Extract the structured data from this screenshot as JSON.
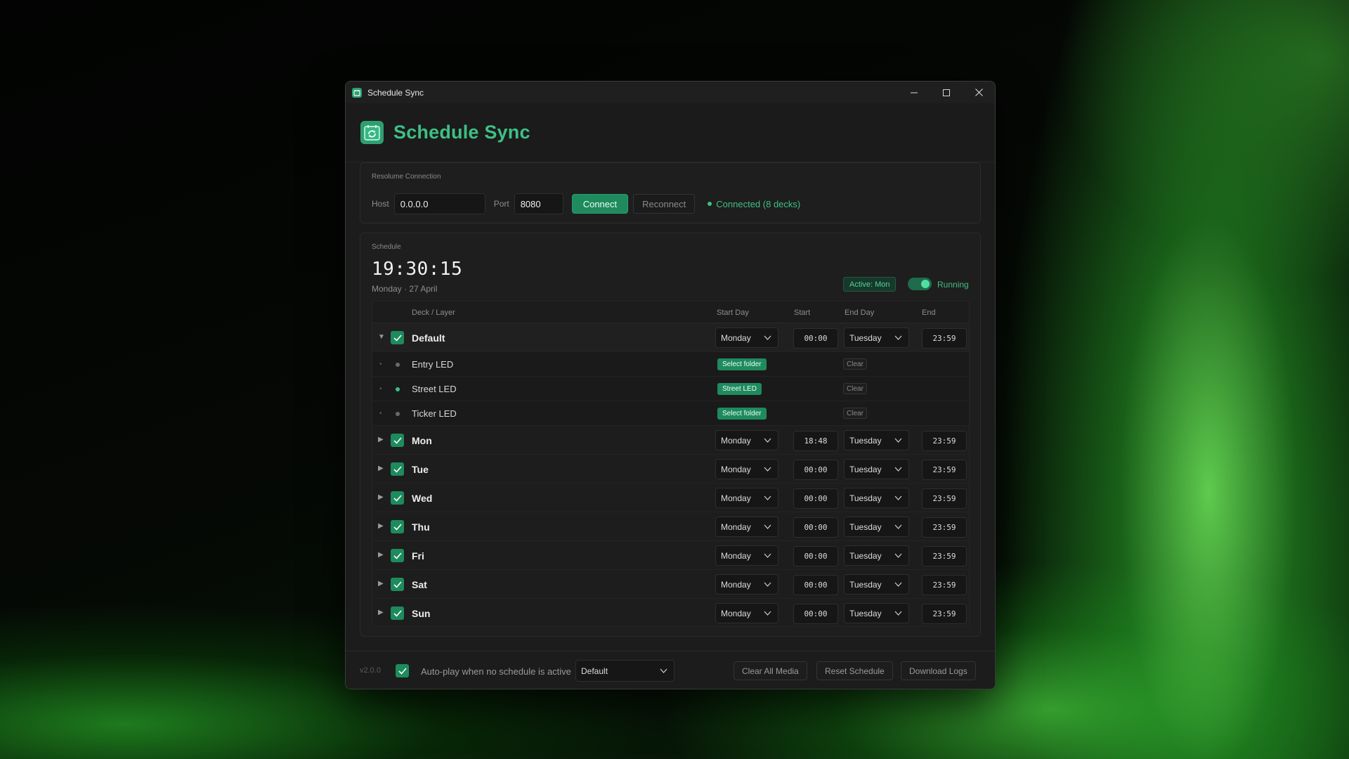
{
  "window": {
    "title": "Schedule Sync",
    "minimize_icon": "minimize-icon",
    "maximize_icon": "maximize-icon",
    "close_icon": "close-icon"
  },
  "app": {
    "title": "Schedule Sync",
    "logo_icon": "calendar-sync-icon",
    "accent": "#3fbf85"
  },
  "connection": {
    "section_label": "Resolume Connection",
    "host_label": "Host",
    "host_value": "0.0.0.0",
    "port_label": "Port",
    "port_value": "8080",
    "connect_label": "Connect",
    "reconnect_label": "Reconnect",
    "status_text": "Connected (8 decks)"
  },
  "schedule": {
    "section_label": "Schedule",
    "clock": "19:30:15",
    "date": "Monday · 27 April",
    "active_badge": "Active: Mon",
    "running_label": "Running",
    "running_on": true,
    "columns": {
      "deck": "Deck / Layer",
      "start_day": "Start Day",
      "start": "Start",
      "end_day": "End Day",
      "end": "End"
    },
    "groups": [
      {
        "name": "Default",
        "checked": true,
        "expanded": true,
        "start_day": "Monday",
        "start": "00:00",
        "end_day": "Tuesday",
        "end": "23:59"
      },
      {
        "name": "Mon",
        "checked": true,
        "expanded": false,
        "start_day": "Monday",
        "start": "18:48",
        "end_day": "Tuesday",
        "end": "23:59"
      },
      {
        "name": "Tue",
        "checked": true,
        "expanded": false,
        "start_day": "Monday",
        "start": "00:00",
        "end_day": "Tuesday",
        "end": "23:59"
      },
      {
        "name": "Wed",
        "checked": true,
        "expanded": false,
        "start_day": "Monday",
        "start": "00:00",
        "end_day": "Tuesday",
        "end": "23:59"
      },
      {
        "name": "Thu",
        "checked": true,
        "expanded": false,
        "start_day": "Monday",
        "start": "00:00",
        "end_day": "Tuesday",
        "end": "23:59"
      },
      {
        "name": "Fri",
        "checked": true,
        "expanded": false,
        "start_day": "Monday",
        "start": "00:00",
        "end_day": "Tuesday",
        "end": "23:59"
      },
      {
        "name": "Sat",
        "checked": true,
        "expanded": false,
        "start_day": "Monday",
        "start": "00:00",
        "end_day": "Tuesday",
        "end": "23:59"
      },
      {
        "name": "Sun",
        "checked": true,
        "expanded": false,
        "start_day": "Monday",
        "start": "00:00",
        "end_day": "Tuesday",
        "end": "23:59"
      }
    ],
    "default_layers": [
      {
        "name": "Entry LED",
        "active": false,
        "folder": "Select folder",
        "clear_label": "Clear"
      },
      {
        "name": "Street LED",
        "active": true,
        "folder": "Street LED",
        "clear_label": "Clear"
      },
      {
        "name": "Ticker LED",
        "active": false,
        "folder": "Select folder",
        "clear_label": "Clear"
      }
    ]
  },
  "footer": {
    "version": "v2.0.0",
    "autoplay_checked": true,
    "autoplay_label": "Auto-play when no schedule is active",
    "autoplay_select": "Default",
    "clear_media_label": "Clear All Media",
    "reset_label": "Reset Schedule",
    "logs_label": "Download Logs"
  }
}
